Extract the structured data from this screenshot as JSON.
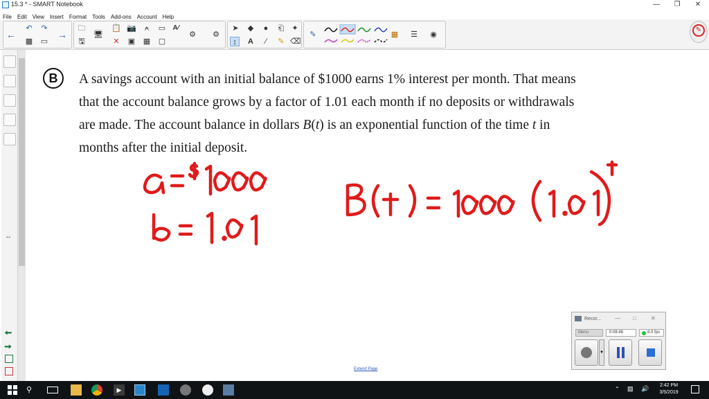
{
  "window": {
    "title": "15.3 * - SMART Notebook"
  },
  "menu": [
    "File",
    "Edit",
    "View",
    "Insert",
    "Format",
    "Tools",
    "Add-ons",
    "Account",
    "Help"
  ],
  "toolbar": {
    "icons": [
      "back-arrow-icon",
      "undo-icon",
      "redo-icon",
      "forward-arrow-icon",
      "open-icon",
      "save-icon",
      "screen-icon",
      "paste-icon",
      "delete-icon",
      "camera-icon",
      "table-icon",
      "select-icon",
      "pen-icon",
      "shape-icon",
      "fill-icon",
      "text-icon",
      "eraser-icon",
      "magic-pen-icon"
    ]
  },
  "problem": {
    "badge": "B",
    "text_1": "A savings account with an initial balance of $1000 earns 1% interest per month. That means",
    "text_2": "that the account balance grows by a factor of 1.01 each month if no deposits or withdrawals",
    "text_3a": "are made. The account balance in dollars ",
    "text_3b": "B",
    "text_3c": "(",
    "text_3d": "t",
    "text_3e": ")",
    "text_3f": " is an exponential function of the time ",
    "text_3g": "t",
    "text_3h": " in",
    "text_4": "months after the initial deposit."
  },
  "handwriting": {
    "a_line": "a = $1000",
    "b_line": "b = 1.01",
    "formula": "B(t) = 1000 (1.01)",
    "exponent": "t",
    "color": "#e01b1b"
  },
  "canvas": {
    "extend_page": "Extend Page"
  },
  "recorder": {
    "title": "Recor...",
    "menu": "Menu",
    "time": "0:08:48",
    "fps": "8.0 fps"
  },
  "clock": {
    "time": "2:42 PM",
    "date": "3/5/2019"
  }
}
